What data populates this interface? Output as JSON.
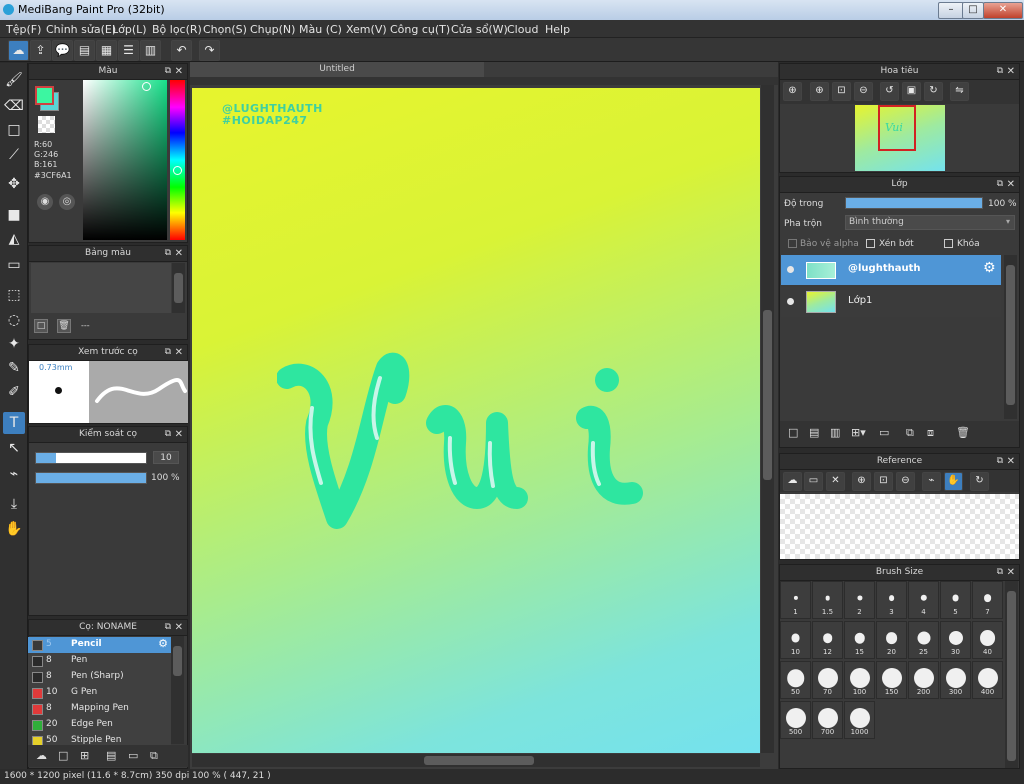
{
  "window": {
    "title": "MediBang Paint Pro (32bit)"
  },
  "menu": [
    "Tệp(F)",
    "Chỉnh sửa(E)",
    "Lớp(L)",
    "Bộ lọc(R)",
    "Chọn(S)",
    "Chụp(N)",
    "Màu (C)",
    "Xem(V)",
    "Công cụ(T)",
    "Cửa sổ(W)",
    "Cloud",
    "Help"
  ],
  "color_panel": {
    "title": "Màu",
    "r": "R:60",
    "g": "G:246",
    "b": "B:161",
    "hex": "#3CF6A1",
    "fg_color": "#3CF6A1",
    "bg_color": "#5ad6d6"
  },
  "palette_panel": {
    "title": "Bảng màu",
    "footer": "---"
  },
  "preview_panel": {
    "title": "Xem trước cọ",
    "size": "0.73mm"
  },
  "control_panel": {
    "title": "Kiểm soát cọ",
    "size_value": "10",
    "opacity_value": "100 %",
    "size_fraction": 0.18,
    "opacity_fraction": 1.0
  },
  "brush_panel": {
    "title": "Cọ: NONAME",
    "items": [
      {
        "num": "5",
        "name": "Pencil",
        "color": "#3a3a3a",
        "selected": true
      },
      {
        "num": "8",
        "name": "Pen",
        "color": "#2a2a2a"
      },
      {
        "num": "8",
        "name": "Pen (Sharp)",
        "color": "#2a2a2a"
      },
      {
        "num": "10",
        "name": "G Pen",
        "color": "#e03a3a"
      },
      {
        "num": "8",
        "name": "Mapping Pen",
        "color": "#e03a3a"
      },
      {
        "num": "20",
        "name": "Edge Pen",
        "color": "#2fae3a"
      },
      {
        "num": "50",
        "name": "Stipple Pen",
        "color": "#e5d02a"
      }
    ]
  },
  "document": {
    "tab": "Untitled",
    "watermark_1": "@LUGHTHAUTH",
    "watermark_2": "#HOIDAP247",
    "drawing_text": "Vui"
  },
  "navigator": {
    "title": "Hoa tiêu",
    "thumb_text": "Vui"
  },
  "layer_panel": {
    "title": "Lớp",
    "opacity_label": "Độ trong",
    "opacity_value": "100 %",
    "opacity_fraction": 1.0,
    "blend_label": "Pha trộn",
    "blend_value": "Bình thường",
    "protect_alpha": "Bảo vệ alpha",
    "clipping": "Xén bớt",
    "lock": "Khóa",
    "layers": [
      {
        "name": "@lughthauth",
        "selected": true
      },
      {
        "name": "Lớp1",
        "selected": false
      }
    ]
  },
  "reference_panel": {
    "title": "Reference"
  },
  "brush_size_panel": {
    "title": "Brush Size",
    "sizes": [
      "1",
      "1.5",
      "2",
      "3",
      "4",
      "5",
      "7",
      "10",
      "12",
      "15",
      "20",
      "25",
      "30",
      "40",
      "50",
      "70",
      "100",
      "150",
      "200",
      "300",
      "400",
      "500",
      "700",
      "1000"
    ]
  },
  "status": {
    "text": "1600 * 1200 pixel   (11.6 * 8.7cm)   350 dpi   100 %   ( 447, 21 )"
  }
}
